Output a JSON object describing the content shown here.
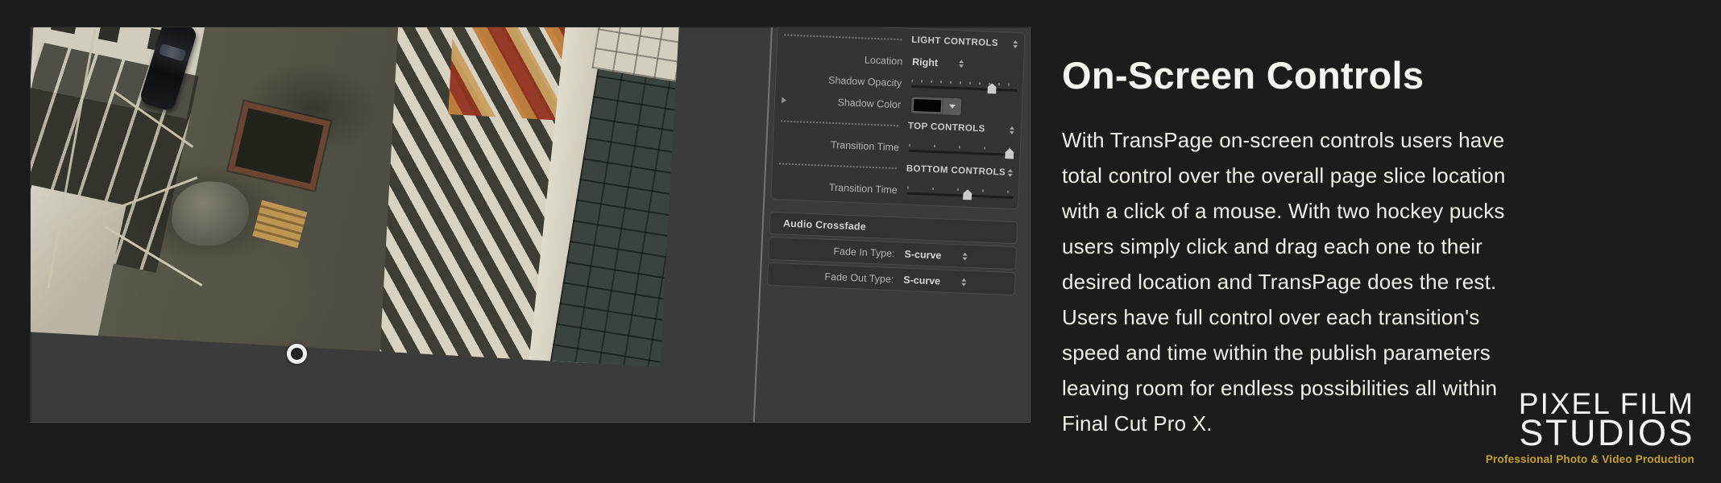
{
  "colors": {
    "page_bg": "#1c1c1c",
    "app_panel_bg": "#3b3b3b",
    "logo_gold": "#c2a02b",
    "text_warm_white": "#f1eee8"
  },
  "icons": {
    "stepper": "css-double-triangle-up-down",
    "disclosure": "css-triangle-right",
    "color_dropdown": "css-triangle-down",
    "hockey_puck": "white-ring-overlay"
  },
  "inspector": {
    "light_header": "LIGHT CONTROLS",
    "location": {
      "label": "Location",
      "value": "Right"
    },
    "shadow_opacity": {
      "label": "Shadow Opacity",
      "pct": 76
    },
    "shadow_color": {
      "label": "Shadow Color",
      "swatch": "#040404"
    },
    "top_header": "TOP CONTROLS",
    "transition_top": {
      "label": "Transition Time",
      "pct": 95
    },
    "bottom_header": "BOTTOM CONTROLS",
    "transition_bottom": {
      "label": "Transition Time",
      "pct": 57
    },
    "audio_header": "Audio Crossfade",
    "fade_in": {
      "label": "Fade In Type:",
      "value": "S-curve"
    },
    "fade_out": {
      "label": "Fade Out Type:",
      "value": "S-curve"
    }
  },
  "content": {
    "heading": "On-Screen Controls",
    "paragraph": "With TransPage on-screen controls users have total control over the overall page slice location with a click of a mouse. With two hockey pucks users simply click and drag each one to their desired location and TransPage does the rest. Users have full control over each transition's speed and time within the publish parameters leaving room for endless possibilities all within Final Cut Pro X."
  },
  "logo": {
    "line1": "PIXEL FILM",
    "line2": "STUDIOS",
    "tagline": "Professional Photo & Video Production"
  }
}
